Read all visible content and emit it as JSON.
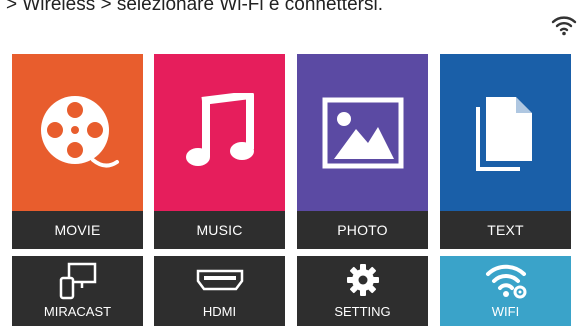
{
  "instruction": "> Wireless > selezionare Wi-Fi e connettersi.",
  "colors": {
    "movie": "#e85d2d",
    "music": "#e61e5c",
    "photo": "#5b4aa3",
    "text": "#1a5fa8",
    "dark_tile": "#2e2e2e",
    "wifi_tile": "#3aa3c9"
  },
  "menu": {
    "movie": {
      "label": "MOVIE",
      "icon": "film-reel-icon"
    },
    "music": {
      "label": "MUSIC",
      "icon": "music-note-icon"
    },
    "photo": {
      "label": "PHOTO",
      "icon": "image-icon"
    },
    "text": {
      "label": "TEXT",
      "icon": "document-icon"
    },
    "miracast": {
      "label": "MIRACAST",
      "icon": "screen-mirror-icon"
    },
    "hdmi": {
      "label": "HDMI",
      "icon": "hdmi-port-icon"
    },
    "setting": {
      "label": "SETTING",
      "icon": "gear-icon"
    },
    "wifi": {
      "label": "WIFI",
      "icon": "wifi-settings-icon"
    }
  }
}
